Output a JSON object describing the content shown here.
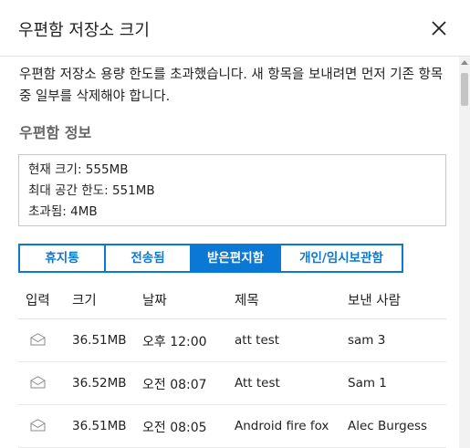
{
  "dialog": {
    "title": "우편함 저장소 크기",
    "close_label": "닫기"
  },
  "warning": "우편함 저장소 용량 한도를 초과했습니다. 새 항목을 보내려면 먼저 기존 항목 중 일부를 삭제해야 합니다.",
  "mailbox_info": {
    "section_title": "우편함 정보",
    "current_size": "현재 크기: 555MB",
    "max_size": "최대 공간 한도: 551MB",
    "exceeded": "초과됨: 4MB"
  },
  "tabs": [
    {
      "label": "휴지통",
      "active": false
    },
    {
      "label": "전송됨",
      "active": false
    },
    {
      "label": "받은편지함",
      "active": true
    },
    {
      "label": "개인/임시보관함",
      "active": false
    }
  ],
  "table": {
    "headers": [
      "입력",
      "크기",
      "날짜",
      "제목",
      "보낸 사람"
    ],
    "rows": [
      {
        "icon": "envelope-icon",
        "size": "36.51MB",
        "date": "오후 12:00",
        "subject": "att test",
        "sender": "sam 3"
      },
      {
        "icon": "envelope-icon",
        "size": "36.52MB",
        "date": "오전 08:07",
        "subject": "Att test",
        "sender": "Sam 1"
      },
      {
        "icon": "envelope-icon",
        "size": "36.51MB",
        "date": "오전 08:05",
        "subject": "Android fire fox",
        "sender": "Alec Burgess"
      }
    ]
  },
  "colors": {
    "accent": "#0a78d4",
    "section_title": "#666666",
    "divider": "#e1e1e1"
  }
}
